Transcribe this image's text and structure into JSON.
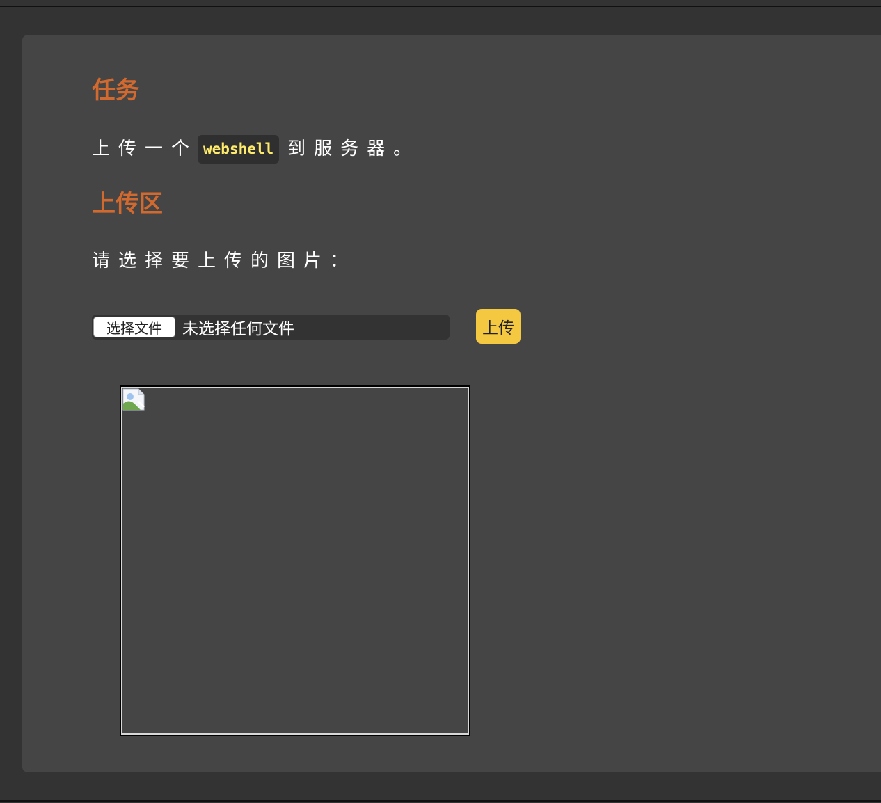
{
  "task": {
    "heading": "任务",
    "text_before": "上传一个",
    "code": "webshell",
    "text_after": "到服务器。"
  },
  "upload": {
    "heading": "上传区",
    "prompt": "请选择要上传的图片：",
    "file_button_label": "选择文件",
    "file_status": "未选择任何文件",
    "submit_label": "上传"
  },
  "preview": {
    "icon": "broken-image-icon"
  },
  "colors": {
    "heading": "#d2692e",
    "code_text": "#ffeb6b",
    "submit_button": "#f5c842",
    "panel": "#454545",
    "background": "#333333"
  }
}
